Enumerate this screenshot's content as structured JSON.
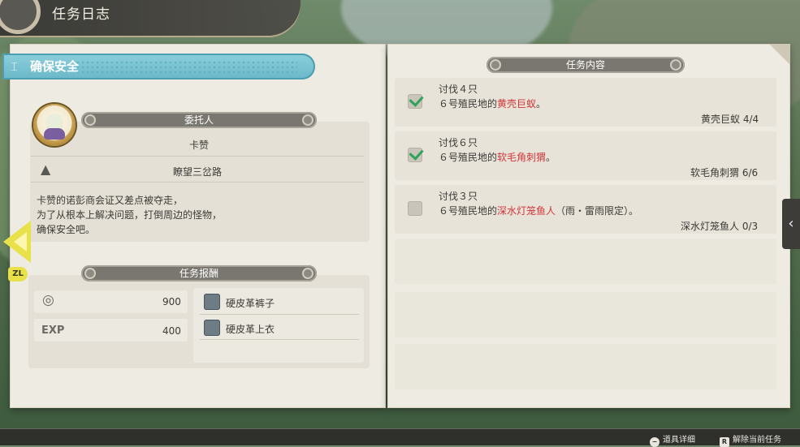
{
  "header": {
    "title": "任务日志"
  },
  "quest": {
    "title": "确保安全",
    "client_section": "委托人",
    "client_name": "卡赞",
    "location": "瞭望三岔路",
    "description": [
      "卡赞的诺彭商会证又差点被夺走，",
      "为了从根本上解决问题，打倒周边的怪物，",
      "确保安全吧。"
    ],
    "reward_section": "任务报酬",
    "rewards": {
      "money": "900",
      "exp_label": "EXP",
      "exp": "400",
      "items": [
        "硬皮革裤子",
        "硬皮革上衣"
      ]
    }
  },
  "tasks": {
    "section": "任务内容",
    "items": [
      {
        "title": "讨伐４只",
        "desc_pre": "６号殖民地的",
        "target": "黄壳巨蚁",
        "desc_post": "。",
        "progress": "黄壳巨蚁 4/4",
        "checked": true
      },
      {
        "title": "讨伐６只",
        "desc_pre": "６号殖民地的",
        "target": "软毛角刺猬",
        "desc_post": "。",
        "progress": "软毛角刺猬 6/6",
        "checked": true
      },
      {
        "title": "讨伐３只",
        "desc_pre": "６号殖民地的",
        "target": "深水灯笼鱼人",
        "desc_post": "（雨・雷雨限定）。",
        "progress": "深水灯笼鱼人 0/3",
        "checked": false
      }
    ]
  },
  "nav": {
    "side_tab": "‹",
    "zl": "ZL"
  },
  "footer": {
    "hint1_btn": "−",
    "hint1": "道具详细",
    "hint2_btn": "R",
    "hint2": "解除当前任务"
  }
}
